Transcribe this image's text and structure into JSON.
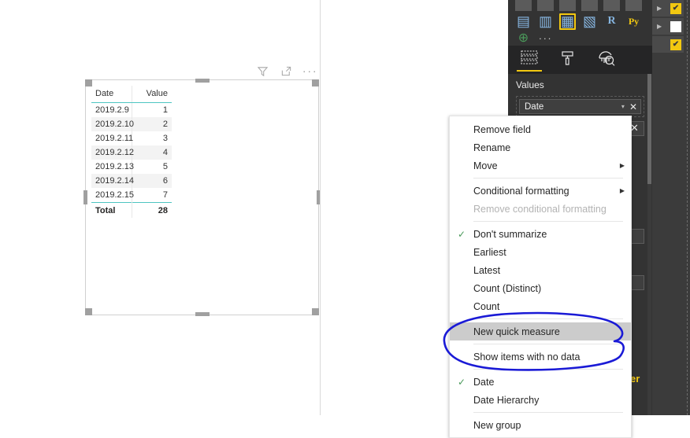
{
  "canvas": {
    "visual_header": {
      "filter_icon": "filter-icon",
      "focus_icon": "focus-mode-icon",
      "more_icon": "more-options-icon",
      "more_label": "···"
    },
    "table_visual": {
      "columns": [
        "Date",
        "Value"
      ],
      "rows": [
        {
          "date": "2019.2.9",
          "value": "1"
        },
        {
          "date": "2019.2.10",
          "value": "2"
        },
        {
          "date": "2019.2.11",
          "value": "3"
        },
        {
          "date": "2019.2.12",
          "value": "4"
        },
        {
          "date": "2019.2.13",
          "value": "5"
        },
        {
          "date": "2019.2.14",
          "value": "6"
        },
        {
          "date": "2019.2.15",
          "value": "7"
        }
      ],
      "total_label": "Total",
      "total_value": "28",
      "accent_color": "#4ec5c1"
    }
  },
  "context_menu": {
    "items": [
      {
        "label": "Remove field",
        "checked": false,
        "submenu": false,
        "disabled": false,
        "highlighted": false,
        "sep_after": false
      },
      {
        "label": "Rename",
        "checked": false,
        "submenu": false,
        "disabled": false,
        "highlighted": false,
        "sep_after": false
      },
      {
        "label": "Move",
        "checked": false,
        "submenu": true,
        "disabled": false,
        "highlighted": false,
        "sep_after": true
      },
      {
        "label": "Conditional formatting",
        "checked": false,
        "submenu": true,
        "disabled": false,
        "highlighted": false,
        "sep_after": false
      },
      {
        "label": "Remove conditional formatting",
        "checked": false,
        "submenu": false,
        "disabled": true,
        "highlighted": false,
        "sep_after": true
      },
      {
        "label": "Don't summarize",
        "checked": true,
        "submenu": false,
        "disabled": false,
        "highlighted": false,
        "sep_after": false
      },
      {
        "label": "Earliest",
        "checked": false,
        "submenu": false,
        "disabled": false,
        "highlighted": false,
        "sep_after": false
      },
      {
        "label": "Latest",
        "checked": false,
        "submenu": false,
        "disabled": false,
        "highlighted": false,
        "sep_after": false
      },
      {
        "label": "Count (Distinct)",
        "checked": false,
        "submenu": false,
        "disabled": false,
        "highlighted": false,
        "sep_after": false
      },
      {
        "label": "Count",
        "checked": false,
        "submenu": false,
        "disabled": false,
        "highlighted": false,
        "sep_after": true
      },
      {
        "label": "New quick measure",
        "checked": false,
        "submenu": false,
        "disabled": false,
        "highlighted": true,
        "sep_after": true
      },
      {
        "label": "Show items with no data",
        "checked": false,
        "submenu": false,
        "disabled": false,
        "highlighted": false,
        "sep_after": true
      },
      {
        "label": "Date",
        "checked": true,
        "submenu": false,
        "disabled": false,
        "highlighted": false,
        "sep_after": false
      },
      {
        "label": "Date Hierarchy",
        "checked": false,
        "submenu": false,
        "disabled": false,
        "highlighted": false,
        "sep_after": true
      },
      {
        "label": "New group",
        "checked": false,
        "submenu": false,
        "disabled": false,
        "highlighted": false,
        "sep_after": false
      }
    ],
    "check_glyph": "✓",
    "submenu_glyph": "▶"
  },
  "annotation": {
    "shape": "hand-drawn-ellipse",
    "color": "#1a1ad6",
    "targets": "Show items with no data"
  },
  "visualizations_pane": {
    "icons_row_top": [
      "map-filled-icon",
      "map-shape-icon",
      "gauge-icon",
      "card-icon",
      "multirow-card-icon",
      "kpi-icon"
    ],
    "icons_row_mid": [
      {
        "name": "slicer-icon",
        "glyph": "▤",
        "selected": false
      },
      {
        "name": "table-filter-icon",
        "glyph": "▥",
        "selected": false
      },
      {
        "name": "table-icon",
        "glyph": "▦",
        "selected": true
      },
      {
        "name": "matrix-icon",
        "glyph": "▧",
        "selected": false
      },
      {
        "name": "r-script-icon",
        "glyph": "R",
        "selected": false
      },
      {
        "name": "python-script-icon",
        "glyph": "Py",
        "selected": false
      }
    ],
    "icons_row_bottom": [
      {
        "name": "arcgis-maps-icon",
        "glyph": "⊕"
      },
      {
        "name": "get-more-visuals-icon",
        "glyph": "···"
      }
    ],
    "tabs": [
      {
        "name": "fields-tab",
        "glyph": "fields",
        "active": true
      },
      {
        "name": "format-tab",
        "glyph": "roller",
        "active": false
      },
      {
        "name": "analytics-tab",
        "glyph": "magnifier",
        "active": false
      }
    ],
    "values_label": "Values",
    "field_pill": {
      "label": "Date",
      "caret": "▾",
      "remove": "✕"
    },
    "selected_visual_border_color": "#f2c811"
  },
  "fields_pane": {
    "rows": [
      {
        "caret": "▶",
        "checked": true
      },
      {
        "caret": "▶",
        "checked": false
      },
      {
        "caret": "",
        "checked": true
      }
    ],
    "check_glyph": "✔",
    "accent_color": "#f2c811"
  },
  "misc": {
    "close_glyph": "✕",
    "partial_text": "er"
  }
}
